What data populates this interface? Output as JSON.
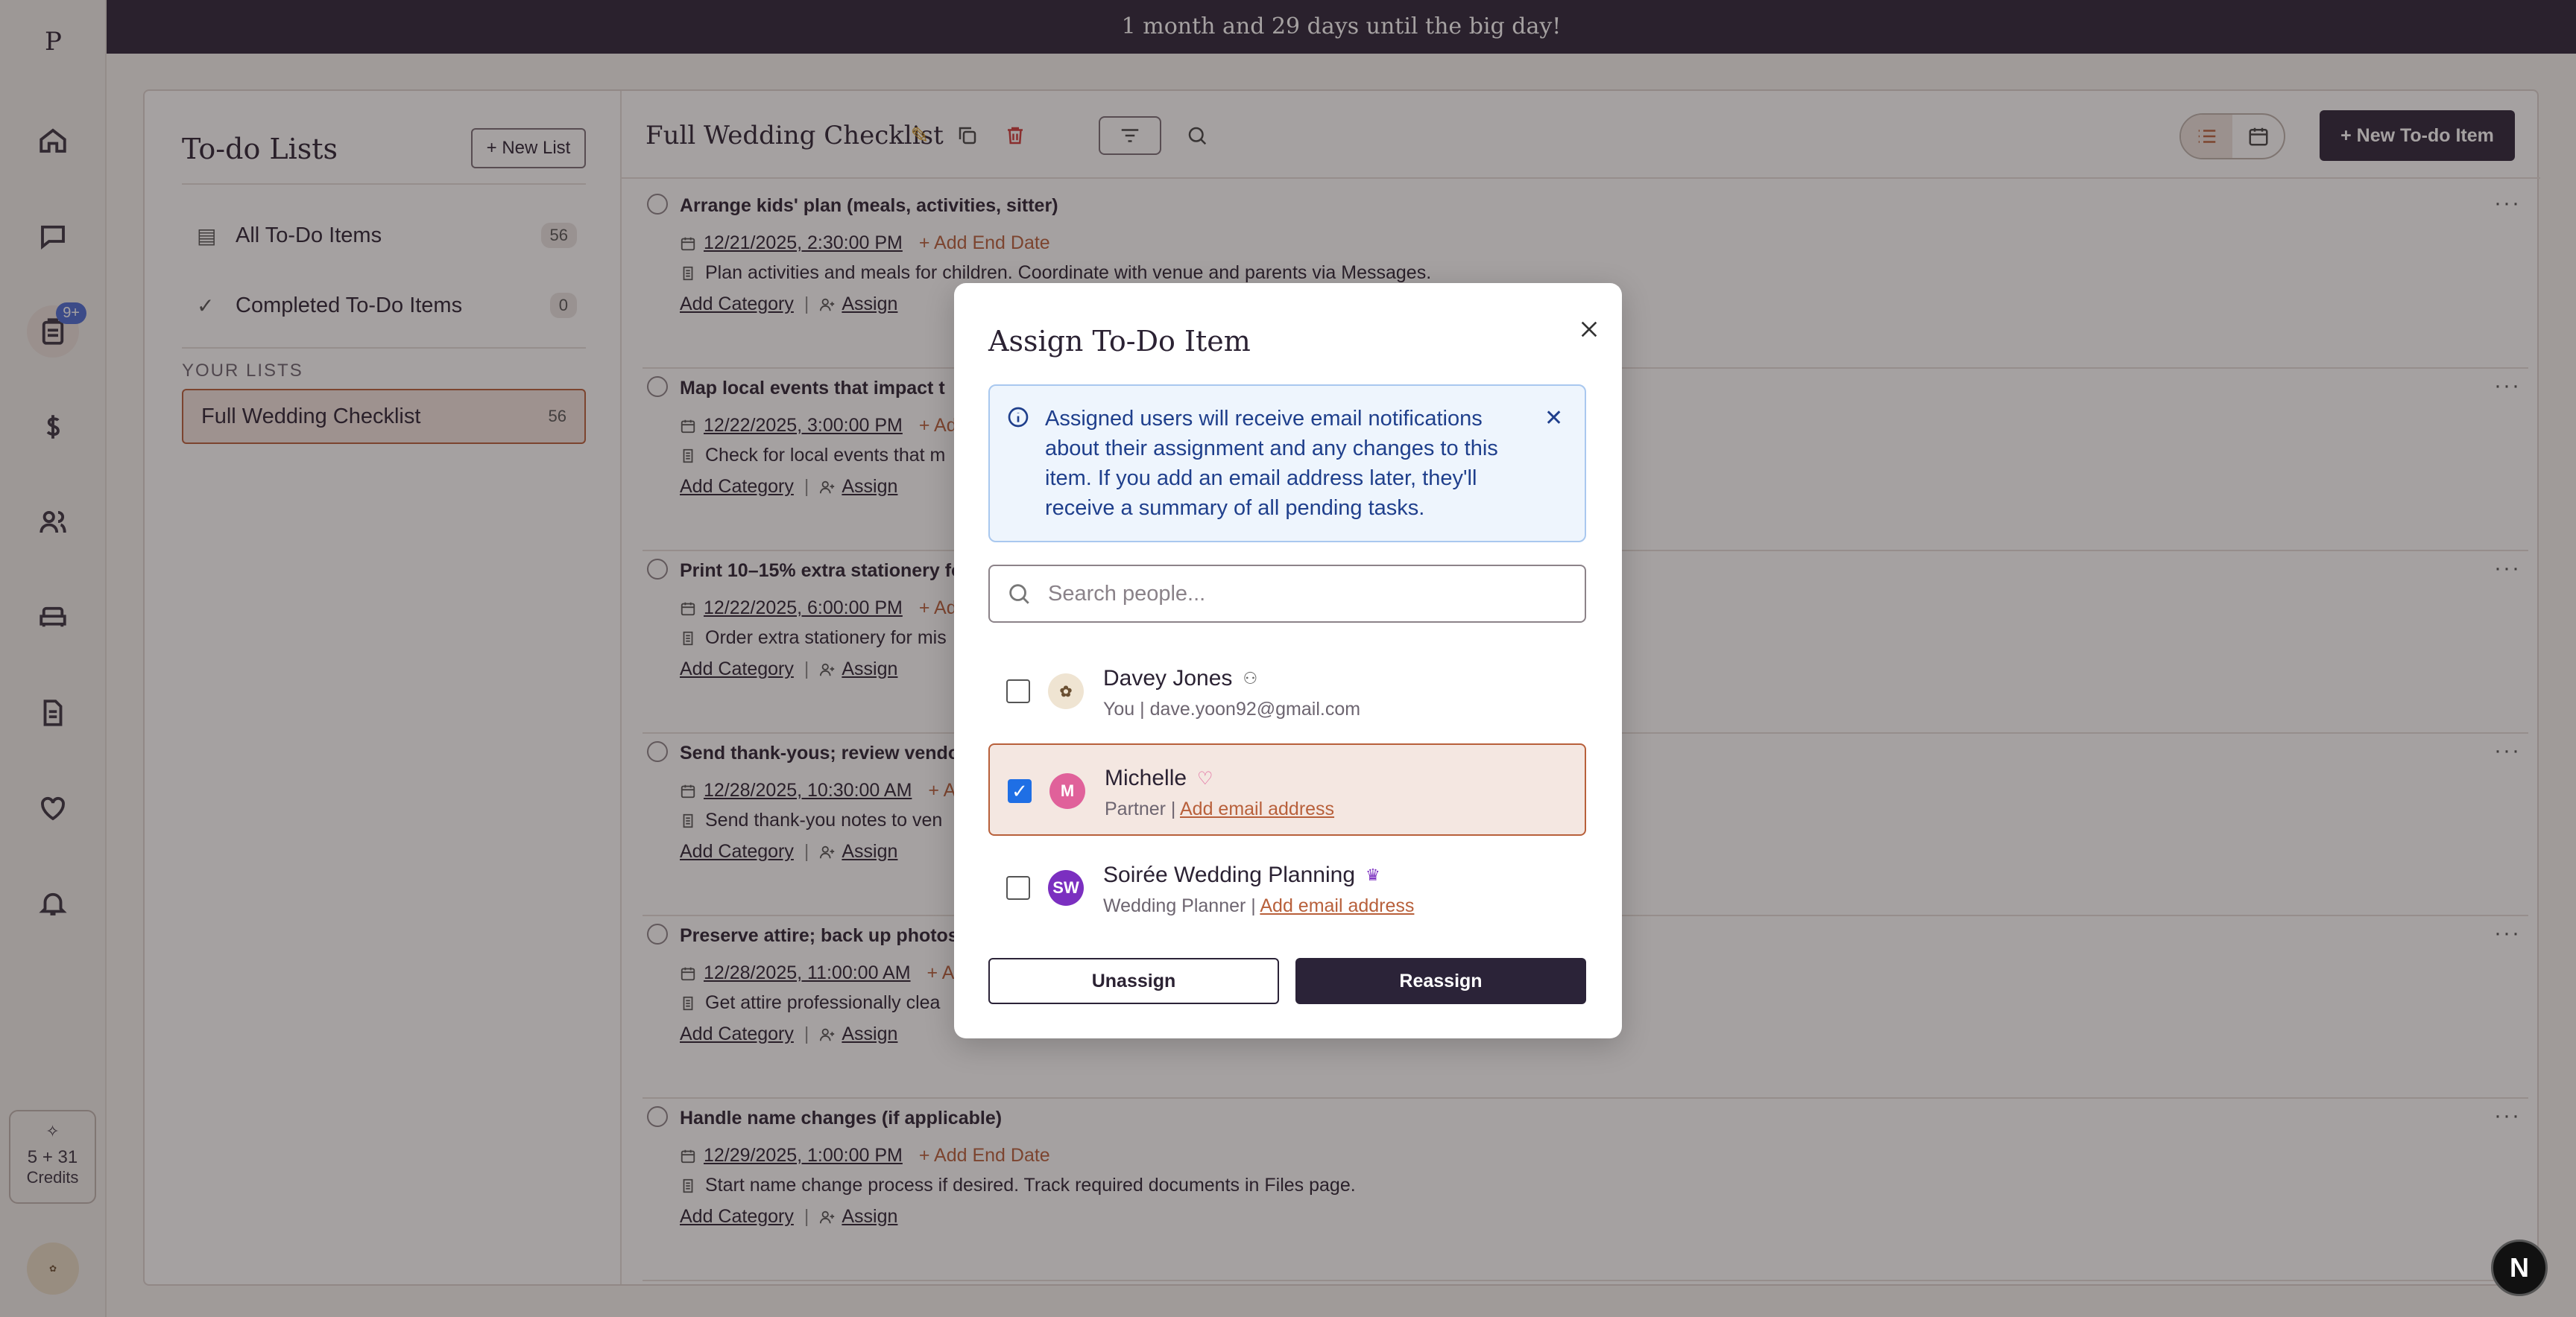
{
  "banner": {
    "text": "1 month and 29 days until the big day!"
  },
  "rail": {
    "logo": "P",
    "badge": "9+",
    "credits_label": "Credits",
    "credits_value": "5 + 31"
  },
  "sidebar": {
    "title": "To-do Lists",
    "new_list": "+ New List",
    "all_items": {
      "label": "All To-Do Items",
      "count": "56"
    },
    "completed": {
      "label": "Completed To-Do Items",
      "count": "0"
    },
    "lists_heading": "YOUR LISTS",
    "list": {
      "label": "Full Wedding Checklist",
      "count": "56"
    }
  },
  "toolbar": {
    "title": "Full Wedding Checklist",
    "new_todo": "+ New To-do Item"
  },
  "task_labels": {
    "add_end": "+ Add End Date",
    "add_category": "Add Category",
    "assign": "Assign",
    "sep": "|",
    "more": "···"
  },
  "tasks": [
    {
      "title": "Arrange kids' plan (meals, activities, sitter)",
      "date": "12/21/2025, 2:30:00 PM",
      "note": "Plan activities and meals for children. Coordinate with venue and parents via Messages."
    },
    {
      "title": "Map local events that impact t",
      "date": "12/22/2025, 3:00:00 PM",
      "note": "Check for local events that m"
    },
    {
      "title": "Print 10–15% extra stationery fo",
      "date": "12/22/2025, 6:00:00 PM",
      "note": "Order extra stationery for mis"
    },
    {
      "title": "Send thank-yous; review vendo",
      "date": "12/28/2025, 10:30:00 AM",
      "note": "Send thank-you notes to ven"
    },
    {
      "title": "Preserve attire; back up photos",
      "date": "12/28/2025, 11:00:00 AM",
      "note": "Get attire professionally clea"
    },
    {
      "title": "Handle name changes (if applicable)",
      "date": "12/29/2025, 1:00:00 PM",
      "note": "Start name change process if desired. Track required documents in Files page."
    }
  ],
  "modal": {
    "title": "Assign To-Do Item",
    "info": "Assigned users will receive email notifications about their assignment and any changes to this item. If you add an email address later, they'll receive a summary of all pending tasks.",
    "search_placeholder": "Search people...",
    "people": [
      {
        "name": "Davey Jones",
        "role": "You",
        "detail": "dave.yoon92@gmail.com",
        "checked": false
      },
      {
        "name": "Michelle",
        "role": "Partner",
        "detail": "Add email address",
        "initials": "M",
        "checked": true
      },
      {
        "name": "Soirée Wedding Planning",
        "role": "Wedding Planner",
        "detail": "Add email address",
        "initials": "SW",
        "checked": false
      }
    ],
    "unassign": "Unassign",
    "reassign": "Reassign"
  },
  "floating": {
    "label": "N"
  },
  "colors": {
    "accent": "#b8603b",
    "dark": "#2b2338",
    "info_bg": "#eef5fd",
    "michelle": "#e0619a",
    "planner": "#7b2fc0"
  }
}
